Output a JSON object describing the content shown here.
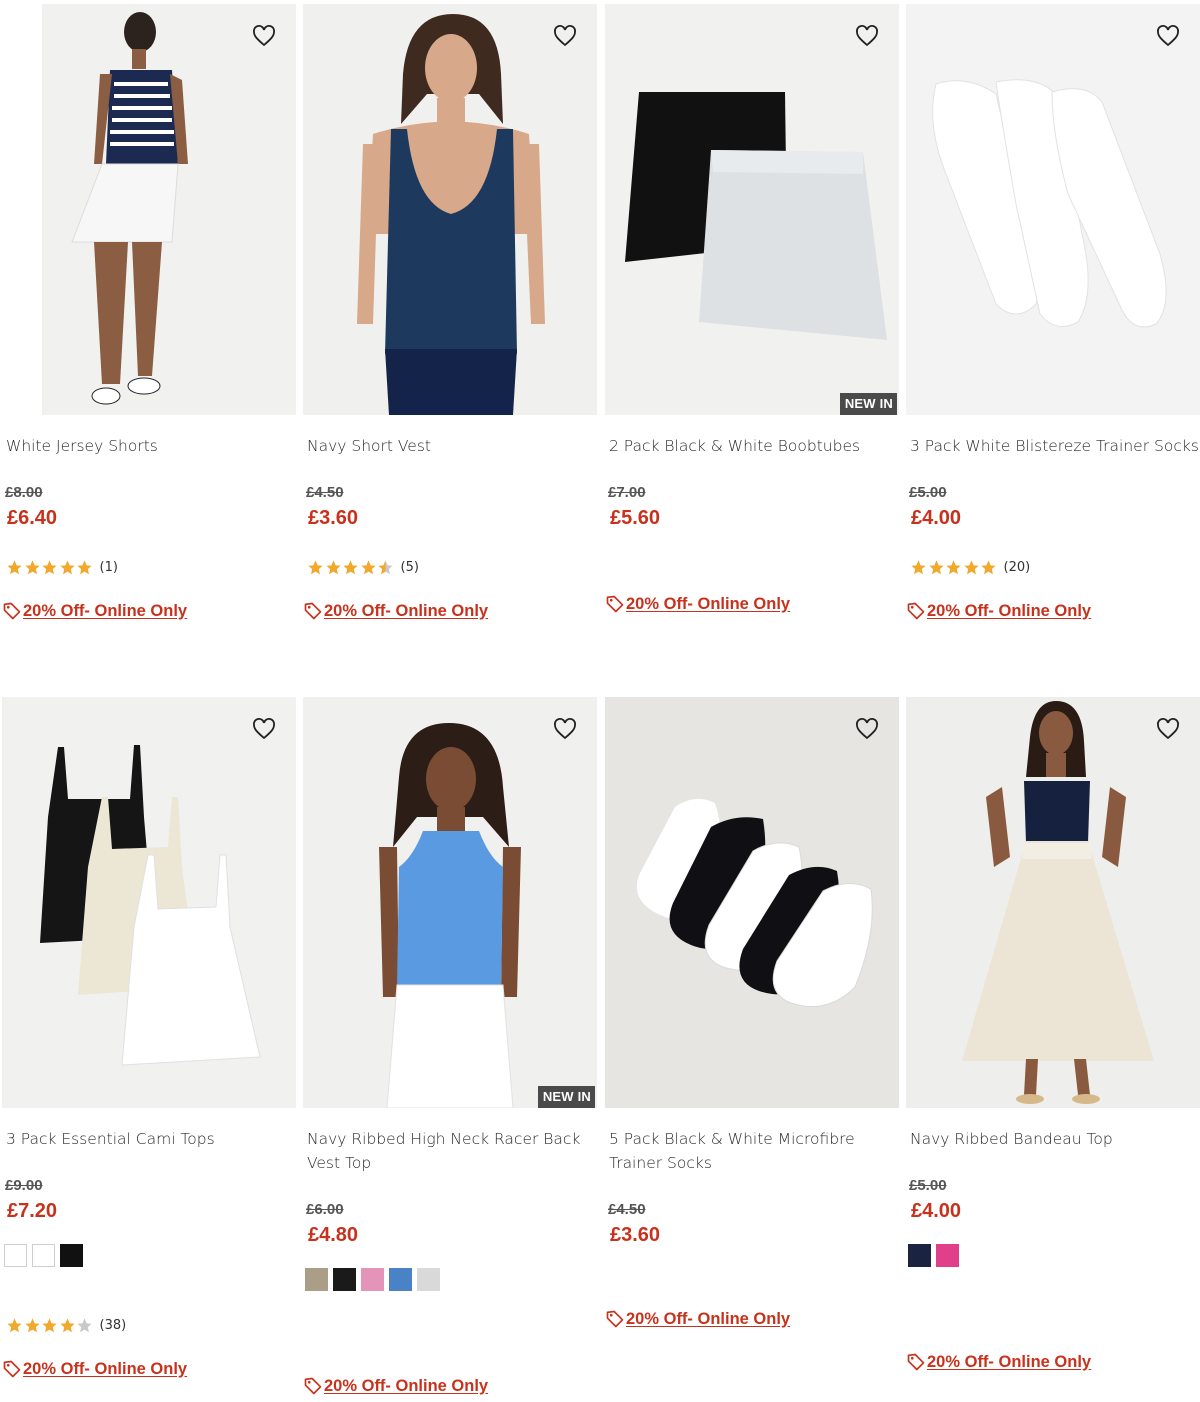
{
  "colors": {
    "accent": "#c8321c",
    "star": "#f0a92a",
    "badge": "#4a4a4a"
  },
  "products": [
    {
      "name": "White Jersey Shorts",
      "was_price": "£8.00",
      "now_price": "£6.40",
      "rating": 5,
      "review_count": "(1)",
      "promo": "20% Off- Online Only",
      "badge": ""
    },
    {
      "name": "Navy Short Vest",
      "was_price": "£4.50",
      "now_price": "£3.60",
      "rating": 4.5,
      "review_count": "(5)",
      "promo": "20% Off- Online Only",
      "badge": ""
    },
    {
      "name": "2 Pack Black & White Boobtubes",
      "was_price": "£7.00",
      "now_price": "£5.60",
      "rating": null,
      "review_count": "",
      "promo": "20% Off- Online Only",
      "badge": "NEW IN"
    },
    {
      "name": "3 Pack White Blistereze Trainer Socks",
      "was_price": "£5.00",
      "now_price": "£4.00",
      "rating": 5,
      "review_count": "(20)",
      "promo": "20% Off- Online Only",
      "badge": ""
    },
    {
      "name": "3 Pack Essential Cami Tops",
      "was_price": "£9.00",
      "now_price": "£7.20",
      "rating": 4,
      "review_count": "(38)",
      "promo": "20% Off- Online Only",
      "badge": "",
      "swatches": [
        "#ffffff",
        "#ffffff",
        "#111111"
      ]
    },
    {
      "name": "Navy Ribbed High Neck Racer Back Vest Top",
      "was_price": "£6.00",
      "now_price": "£4.80",
      "rating": null,
      "review_count": "",
      "promo": "20% Off- Online Only",
      "badge": "NEW IN",
      "swatches": [
        "#aa9e86",
        "#1a1a1a",
        "#e394b8",
        "#4a82c6",
        "#d9d9d9"
      ]
    },
    {
      "name": "5 Pack Black & White Microfibre Trainer Socks",
      "was_price": "£4.50",
      "now_price": "£3.60",
      "rating": null,
      "review_count": "",
      "promo": "20% Off- Online Only",
      "badge": ""
    },
    {
      "name": "Navy Ribbed Bandeau Top",
      "was_price": "£5.00",
      "now_price": "£4.00",
      "rating": null,
      "review_count": "",
      "promo": "20% Off- Online Only",
      "badge": "",
      "swatches": [
        "#1a2340",
        "#e0408a"
      ]
    }
  ]
}
